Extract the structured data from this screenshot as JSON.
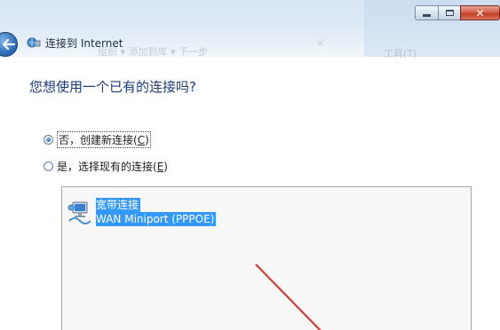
{
  "window": {
    "title": "连接到 Internet"
  },
  "background_ghost_text": {
    "top_right": "",
    "right_toolbar": "工具(T)",
    "left_toolbar": "组织 ▾   添加到库 ▾   下一步"
  },
  "wizard": {
    "question": "您想使用一个已有的连接吗?",
    "options": [
      {
        "label_main": "否，创建新连接(",
        "hotkey": "C",
        "label_end": ")",
        "checked": true
      },
      {
        "label_main": "是，选择现有的连接(",
        "hotkey": "E",
        "label_end": ")",
        "checked": false
      }
    ],
    "connections": [
      {
        "name": "宽带连接",
        "device": "WAN Miniport (PPPOE)",
        "icon": "network-connection-icon",
        "selected": true
      }
    ]
  },
  "colors": {
    "question_text": "#1e3b7a",
    "selection": "#3399ff",
    "annotation_arrow": "#d43a3a",
    "close_button": "#c43f23"
  }
}
